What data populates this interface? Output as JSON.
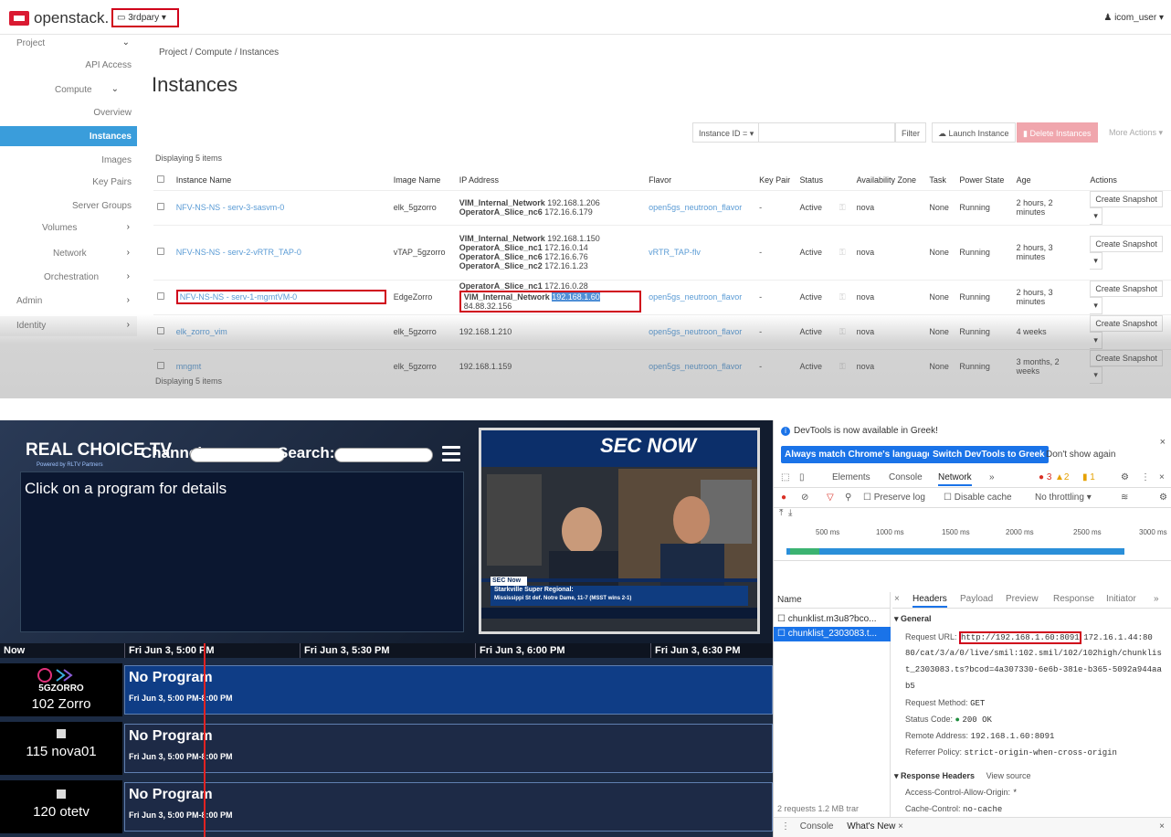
{
  "openstack": {
    "logo": "openstack.",
    "project_dropdown": "3rdpary ▾",
    "user_dropdown": "icom_user ▾",
    "sidebar": {
      "project": "Project",
      "api_access": "API Access",
      "compute": "Compute",
      "overview": "Overview",
      "instances": "Instances",
      "images": "Images",
      "key_pairs": "Key Pairs",
      "server_groups": "Server Groups",
      "volumes": "Volumes",
      "network": "Network",
      "orchestration": "Orchestration",
      "admin": "Admin",
      "identity": "Identity"
    },
    "breadcrumb": "Project / Compute / Instances",
    "title": "Instances",
    "toolbar": {
      "filter_field": "Instance ID = ▾",
      "filter": "Filter",
      "launch": "Launch Instance",
      "delete": "Delete Instances",
      "more": "More Actions ▾"
    },
    "displaying": "Displaying 5 items",
    "columns": [
      "Instance Name",
      "Image Name",
      "IP Address",
      "Flavor",
      "Key Pair",
      "Status",
      "",
      "Availability Zone",
      "Task",
      "Power State",
      "Age",
      "Actions"
    ],
    "rows": [
      {
        "name": "NFV-NS-NS - serv-3-sasvm-0",
        "image": "elk_5gzorro",
        "ip": [
          [
            "VIM_Internal_Network",
            "192.168.1.206"
          ],
          [
            "OperatorA_Slice_nc6",
            "172.16.6.179"
          ]
        ],
        "flavor": "open5gs_neutroon_flavor",
        "key": "-",
        "status": "Active",
        "az": "nova",
        "task": "None",
        "power": "Running",
        "age": "2 hours, 2 minutes",
        "action": "Create Snapshot"
      },
      {
        "name": "NFV-NS-NS - serv-2-vRTR_TAP-0",
        "image": "vTAP_5gzorro",
        "ip": [
          [
            "VIM_Internal_Network",
            "192.168.1.150"
          ],
          [
            "OperatorA_Slice_nc1",
            "172.16.0.14"
          ],
          [
            "OperatorA_Slice_nc6",
            "172.16.6.76"
          ],
          [
            "OperatorA_Slice_nc2",
            "172.16.1.23"
          ]
        ],
        "flavor": "vRTR_TAP-flv",
        "key": "-",
        "status": "Active",
        "az": "nova",
        "task": "None",
        "power": "Running",
        "age": "2 hours, 3 minutes",
        "action": "Create Snapshot"
      },
      {
        "name": "NFV-NS-NS - serv-1-mgmtVM-0",
        "image": "EdgeZorro",
        "ip_a": "OperatorA_Slice_nc1",
        "ip_a_val": "172.16.0.28",
        "ip_b": "VIM_Internal_Network",
        "ip_b_hl": "192.168.1.60",
        "ip_b_rest": "84.88.32.156",
        "flavor": "open5gs_neutroon_flavor",
        "key": "-",
        "status": "Active",
        "az": "nova",
        "task": "None",
        "power": "Running",
        "age": "2 hours, 3 minutes",
        "action": "Create Snapshot"
      },
      {
        "name": "elk_zorro_vim",
        "image": "elk_5gzorro",
        "ip_single": "192.168.1.210",
        "flavor": "open5gs_neutroon_flavor",
        "key": "-",
        "status": "Active",
        "az": "nova",
        "task": "None",
        "power": "Running",
        "age": "4 weeks",
        "action": "Create Snapshot"
      },
      {
        "name": "mngmt",
        "image": "elk_5gzorro",
        "ip_single": "192.168.1.159",
        "flavor": "open5gs_neutroon_flavor",
        "key": "-",
        "status": "Active",
        "az": "nova",
        "task": "None",
        "power": "Running",
        "age": "3 months, 2 weeks",
        "action": "Create Snapshot"
      }
    ]
  },
  "tv": {
    "logo": "REAL CHOICE TV",
    "logo_sub": "Powered by RLTV Partners",
    "channel_label": "Channel:",
    "search_label": "Search:",
    "details": "Click on a program for details",
    "video_ticker": "SEC Now",
    "video_headline": "Starkville Super Regional:",
    "video_sub": "Mississippi St def. Notre Dame, 11-7 (MSST wins 2-1)",
    "video_brand": "SEC NOW",
    "now": "Now",
    "times": [
      "Fri Jun 3, 5:00 PM",
      "Fri Jun 3, 5:30 PM",
      "Fri Jun 3, 6:00 PM",
      "Fri Jun 3, 6:30 PM"
    ],
    "channels": [
      {
        "logo": "5GZORRO",
        "name": "102 Zorro",
        "program": "No Program",
        "time": "Fri Jun 3, 5:00 PM-8:00 PM"
      },
      {
        "logo": "",
        "name": "115 nova01",
        "program": "No Program",
        "time": "Fri Jun 3, 5:00 PM-8:00 PM"
      },
      {
        "logo": "",
        "name": "120 otetv",
        "program": "No Program",
        "time": "Fri Jun 3, 5:00 PM-8:00 PM"
      }
    ]
  },
  "devtools": {
    "info": "DevTools is now available in Greek!",
    "btn_match": "Always match Chrome's language",
    "btn_switch": "Switch DevTools to Greek",
    "dont_show": "Don't show again",
    "tabs": [
      "Elements",
      "Console",
      "Network",
      "»"
    ],
    "errors": "3",
    "warnings": "2",
    "issues": "1",
    "preserve_log": "Preserve log",
    "disable_cache": "Disable cache",
    "throttling": "No throttling",
    "timeline": [
      "500 ms",
      "1000 ms",
      "1500 ms",
      "2000 ms",
      "2500 ms",
      "3000 ms"
    ],
    "name_header": "Name",
    "requests": [
      "chunklist.m3u8?bco...",
      "chunklist_2303083.t..."
    ],
    "footer": "2 requests  1.2 MB trar",
    "detail_tabs": [
      "Headers",
      "Payload",
      "Preview",
      "Response",
      "Initiator",
      "»"
    ],
    "general": "General",
    "request_url_label": "Request URL:",
    "request_url_boxed": "http://192.168.1.60:8091",
    "request_url_rest1": "172.16.1.44:80",
    "request_url_rest2": "80/cat/3/a/0/live/smil:102.smil/102/102high/chunklis",
    "request_url_rest3": "t_2303083.ts?bcod=4a307330-6e6b-381e-b365-5092a944aa",
    "request_url_rest4": "b5",
    "method_label": "Request Method:",
    "method": "GET",
    "status_label": "Status Code:",
    "status": "200 OK",
    "remote_label": "Remote Address:",
    "remote": "192.168.1.60:8091",
    "referrer_label": "Referrer Policy:",
    "referrer": "strict-origin-when-cross-origin",
    "response_headers": "Response Headers",
    "view_source": "View source",
    "acao_label": "Access-Control-Allow-Origin:",
    "acao": "*",
    "cache_label": "Cache-Control:",
    "cache": "no-cache",
    "bottom_tabs": [
      "Console",
      "What's New"
    ]
  }
}
